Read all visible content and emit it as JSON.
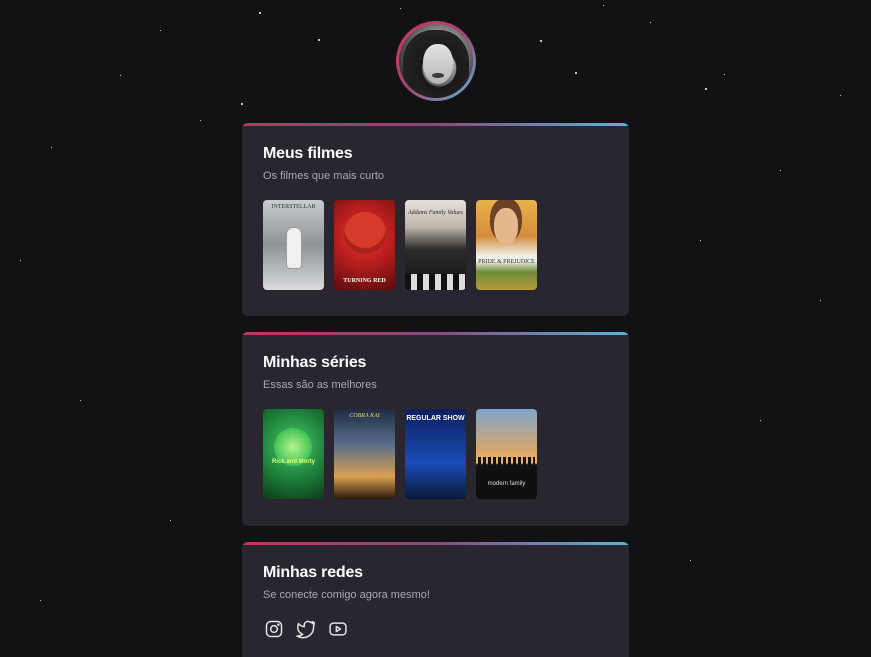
{
  "profile": {
    "avatar_alt": ""
  },
  "movies": {
    "title": "Meus filmes",
    "subtitle": "Os filmes que mais curto",
    "posters": [
      {
        "name": "interstellar",
        "caption": "INTERSTELLAR"
      },
      {
        "name": "turning-red",
        "caption": "TURNING RED"
      },
      {
        "name": "addams-family-values",
        "caption": "Addams Family Values"
      },
      {
        "name": "pride-prejudice",
        "caption": "PRIDE & PREJUDICE"
      }
    ]
  },
  "series": {
    "title": "Minhas séries",
    "subtitle": "Essas são as melhores",
    "posters": [
      {
        "name": "rick-and-morty",
        "caption": "Rick and Morty"
      },
      {
        "name": "cobra-kai",
        "caption": "COBRA KAI"
      },
      {
        "name": "regular-show",
        "caption": "REGULAR SHOW"
      },
      {
        "name": "modern-family",
        "caption": "modern family"
      }
    ]
  },
  "socials": {
    "title": "Minhas redes",
    "subtitle": "Se conecte comigo agora mesmo!",
    "icons": [
      "instagram-icon",
      "twitter-icon",
      "youtube-icon"
    ]
  },
  "colors": {
    "background": "#121214",
    "card": "#29262f",
    "accent_start": "#c1365a",
    "accent_end": "#5ab4d8"
  }
}
